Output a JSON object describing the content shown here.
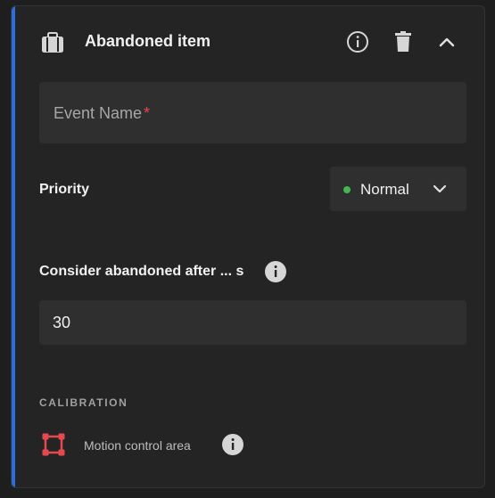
{
  "header": {
    "title": "Abandoned item",
    "icon": "briefcase-icon",
    "actions": [
      "info-icon",
      "trash-icon",
      "chevron-up-icon"
    ]
  },
  "event_name": {
    "placeholder": "Event Name",
    "required_mark": "*"
  },
  "priority": {
    "label": "Priority",
    "value": "Normal",
    "status_color": "#3fb950"
  },
  "abandon": {
    "label": "Consider abandoned after ... s",
    "value": "30"
  },
  "calibration": {
    "heading": "CALIBRATION",
    "motion_label": "Motion control area",
    "motion_icon_color": "#e5484d"
  },
  "colors": {
    "accent": "#2d6cdf",
    "background": "#242424"
  }
}
